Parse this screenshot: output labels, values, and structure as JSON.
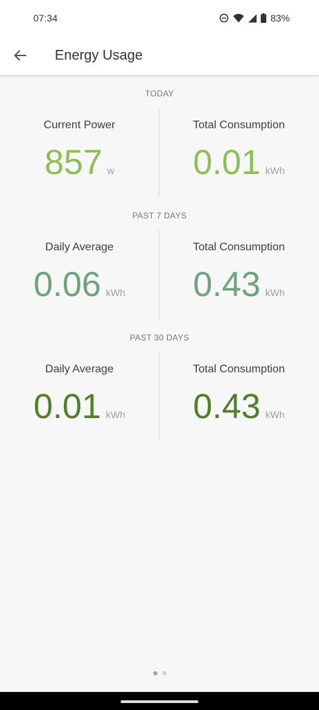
{
  "status_bar": {
    "time": "07:34",
    "battery": "83%",
    "icons": [
      "dnd-icon",
      "wifi-icon",
      "signal-icon",
      "battery-icon"
    ]
  },
  "app_bar": {
    "title": "Energy Usage",
    "back_icon": "arrow-left-icon"
  },
  "sections": [
    {
      "header": "TODAY",
      "left": {
        "label": "Current Power",
        "value": "857",
        "unit": "w"
      },
      "right": {
        "label": "Total Consumption",
        "value": "0.01",
        "unit": "kWh"
      }
    },
    {
      "header": "PAST 7 DAYS",
      "left": {
        "label": "Daily Average",
        "value": "0.06",
        "unit": "kWh"
      },
      "right": {
        "label": "Total Consumption",
        "value": "0.43",
        "unit": "kWh"
      }
    },
    {
      "header": "PAST 30 DAYS",
      "left": {
        "label": "Daily Average",
        "value": "0.01",
        "unit": "kWh"
      },
      "right": {
        "label": "Total Consumption",
        "value": "0.43",
        "unit": "kWh"
      }
    }
  ],
  "colors": {
    "today": "#8cc152",
    "past_7_days": "#6aa37c",
    "past_30_days": "#4e7f2a",
    "indicator_active": "#7fb68a",
    "indicator_inactive": "#cfcfcf"
  },
  "page_indicator": {
    "count": 2,
    "active": 1
  }
}
